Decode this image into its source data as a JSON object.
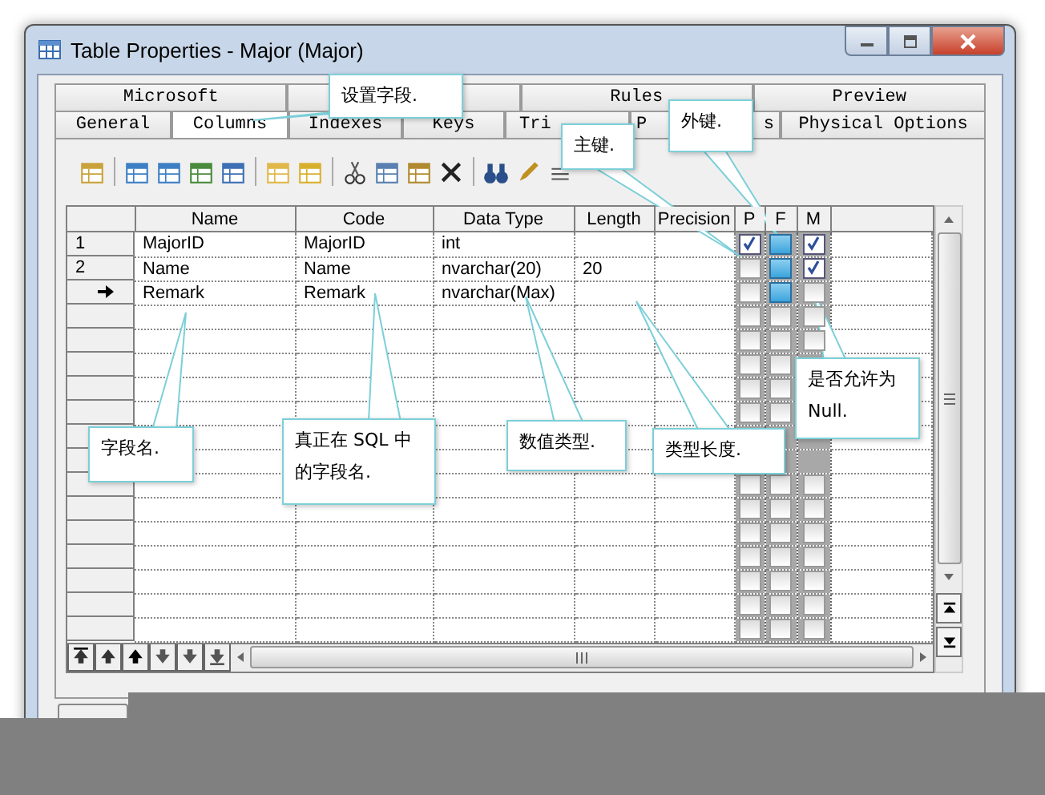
{
  "window": {
    "title": "Table Properties - Major (Major)"
  },
  "tab_rows": [
    [
      {
        "label": "Microsoft",
        "selected": false
      },
      {
        "selected": false
      },
      {
        "label": "Rules",
        "selected": false
      },
      {
        "label": "Preview",
        "selected": false
      }
    ],
    [
      {
        "label": "General",
        "selected": false
      },
      {
        "label": "Columns",
        "selected": true
      },
      {
        "label": "Indexes",
        "selected": false
      },
      {
        "label": "Keys",
        "selected": false
      },
      {
        "label": "Tri",
        "selected": false
      },
      {
        "label": "P",
        "label_end": "s",
        "selected": false
      },
      {
        "label": "Physical Options",
        "selected": false
      }
    ]
  ],
  "table": {
    "columns": [
      "Name",
      "Code",
      "Data Type",
      "Length",
      "Precision",
      "P",
      "F",
      "M"
    ],
    "rows": [
      {
        "number": "1",
        "current": false,
        "name": "MajorID",
        "code": "MajorID",
        "data_type": "int",
        "p": true,
        "f": true,
        "m": true
      },
      {
        "number": "2",
        "current": false,
        "name": "Name",
        "code": "Name",
        "data_type": "nvarchar(20)",
        "length": "20",
        "p": false,
        "f": true,
        "m": true
      },
      {
        "current": true,
        "name": "Remark",
        "code": "Remark",
        "data_type": "nvarchar(Max)",
        "p": false,
        "f": true,
        "m": false
      },
      {
        "current": false,
        "p": false,
        "f": false,
        "m": false
      },
      {
        "current": false,
        "p": false,
        "f": false,
        "m": false
      },
      {
        "current": false,
        "p": false,
        "f": false
      },
      {
        "current": false,
        "p": false,
        "f": false
      },
      {
        "current": false,
        "p": false,
        "f": false
      },
      {},
      {},
      {
        "current": false,
        "p": false,
        "f": false,
        "m": false
      },
      {
        "current": false,
        "p": false,
        "f": false,
        "m": false
      },
      {
        "current": false,
        "p": false,
        "f": false,
        "m": false
      },
      {
        "current": false,
        "p": false,
        "f": false,
        "m": false
      },
      {
        "current": false,
        "p": false,
        "f": false,
        "m": false
      },
      {
        "current": false,
        "p": false,
        "f": false,
        "m": false
      },
      {
        "current": false,
        "p": false,
        "f": false,
        "m": false
      }
    ]
  },
  "callouts": [
    {
      "lines": [
        "设置字段."
      ]
    },
    {
      "lines": [
        "主键."
      ]
    },
    {
      "lines": [
        "外键."
      ]
    },
    {
      "lines": [
        "字段名."
      ]
    },
    {
      "lines": [
        "真正在 SQL 中",
        "的字段名."
      ]
    },
    {
      "lines": [
        "数值类型."
      ]
    },
    {
      "lines": [
        "类型长度."
      ]
    },
    {
      "lines": [
        "是否允许为",
        "Null."
      ]
    }
  ]
}
